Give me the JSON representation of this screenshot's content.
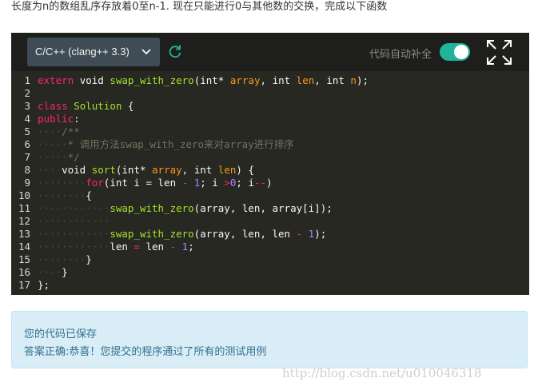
{
  "prompt_text": "长度为n的数组乱序存放着0至n-1. 现在只能进行0与其他数的交换，完成以下函数",
  "toolbar": {
    "language": "C/C++ (clang++ 3.3)",
    "autocomplete_label": "代码自动补全",
    "autocomplete_on": true,
    "icons": [
      "chevron-down-icon",
      "refresh-icon",
      "fullscreen-icon"
    ],
    "accent_color": "#20b59a"
  },
  "code": {
    "line_numbers": [
      "1",
      "2",
      "3",
      "4",
      "5",
      "6",
      "7",
      "8",
      "9",
      "10",
      "11",
      "12",
      "13",
      "14",
      "15",
      "16",
      "17"
    ],
    "lines": [
      "extern void swap_with_zero(int* array, int len, int n);",
      "",
      "class Solution {",
      "public:",
      "    /**",
      "     * 调用方法swap_with_zero来对array进行排序",
      "     */",
      "    void sort(int* array, int len) {",
      "        for(int i = len - 1; i >0; i--)",
      "        {",
      "            swap_with_zero(array, len, array[i]);",
      "",
      "            swap_with_zero(array, len, len - 1);",
      "            len = len - 1;",
      "        }",
      "    }",
      "};"
    ]
  },
  "result": {
    "saved": "您的代码已保存",
    "message": "答案正确:恭喜！您提交的程序通过了所有的测试用例"
  },
  "watermark": "http://blog.csdn.net/u010046318"
}
